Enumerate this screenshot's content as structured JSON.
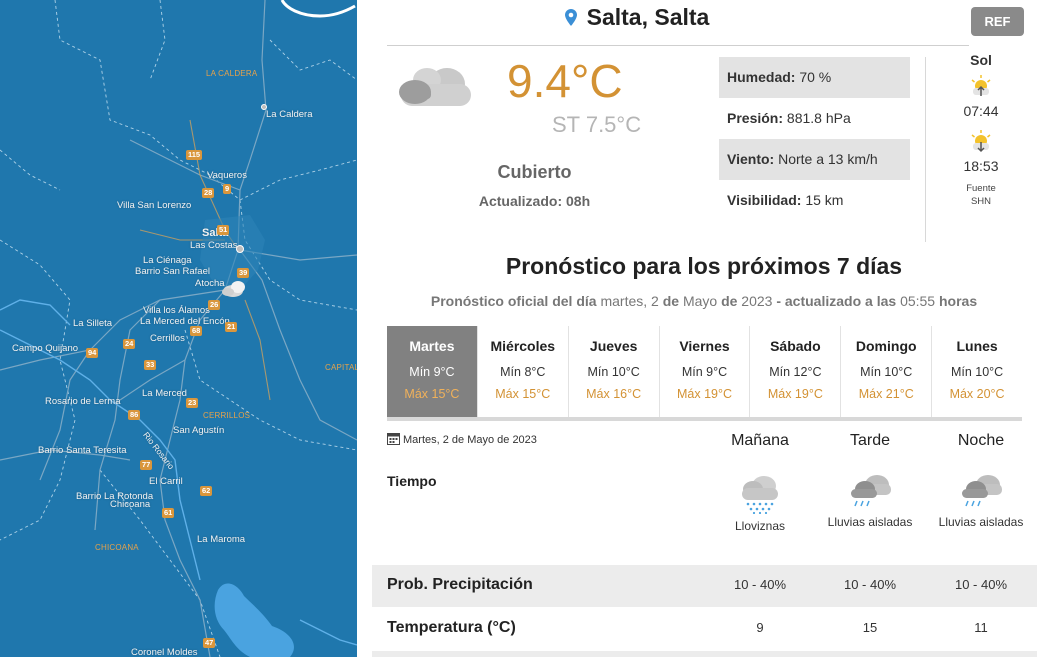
{
  "map": {
    "cities": [
      {
        "name": "La Caldera",
        "style": "city"
      },
      {
        "name": "Vaqueros",
        "style": "city"
      },
      {
        "name": "Villa San Lorenzo",
        "style": "city"
      },
      {
        "name": "Salta",
        "style": "big"
      },
      {
        "name": "Las Costas",
        "style": "city"
      },
      {
        "name": "La Ciénaga",
        "style": "city"
      },
      {
        "name": "Barrio San Rafael",
        "style": "city"
      },
      {
        "name": "Atocha",
        "style": "city"
      },
      {
        "name": "Villa los Álamos",
        "style": "city"
      },
      {
        "name": "La Merced del Encón",
        "style": "city"
      },
      {
        "name": "La Silleta",
        "style": "city"
      },
      {
        "name": "Cerrillos",
        "style": "city"
      },
      {
        "name": "Campo Quijano",
        "style": "city"
      },
      {
        "name": "La Merced",
        "style": "city"
      },
      {
        "name": "Rosario de Lerma",
        "style": "city"
      },
      {
        "name": "San Agustín",
        "style": "city"
      },
      {
        "name": "Barrio Santa Teresita",
        "style": "city"
      },
      {
        "name": "El Carril",
        "style": "city"
      },
      {
        "name": "Barrio La Rotonda",
        "style": "city"
      },
      {
        "name": "Chicoana",
        "style": "city"
      },
      {
        "name": "La Maroma",
        "style": "city"
      },
      {
        "name": "Coronel Moldes",
        "style": "city"
      }
    ],
    "regions": [
      "LA CALDERA",
      "CERRILLOS",
      "CHICOANA",
      "CAPITAL"
    ],
    "river": "Rio Rosario",
    "routes": [
      "9",
      "28",
      "39",
      "51",
      "26",
      "21",
      "24",
      "94",
      "33",
      "23",
      "47",
      "68",
      "77",
      "86",
      "62",
      "61",
      "115"
    ]
  },
  "location": {
    "name": "Salta, Salta",
    "ref_button": "REF"
  },
  "current": {
    "temperature": "9.4°C",
    "feels_like": "ST 7.5°C",
    "condition": "Cubierto",
    "updated": "Actualizado: 08h",
    "icon": "cloud-icon"
  },
  "stats": [
    {
      "label": "Humedad:",
      "value": "70 %"
    },
    {
      "label": "Presión:",
      "value": "881.8 hPa"
    },
    {
      "label": "Viento:",
      "value": "Norte a 13 km/h"
    },
    {
      "label": "Visibilidad:",
      "value": "15 km"
    }
  ],
  "sun": {
    "title": "Sol",
    "sunrise": "07:44",
    "sunset": "18:53",
    "source_label": "Fuente",
    "source": "SHN"
  },
  "forecast": {
    "title": "Pronóstico para los próximos 7 días",
    "subtitle_prefix": "Pronóstico oficial del día",
    "subtitle_date_1": "martes, 2",
    "subtitle_de_1": "de",
    "subtitle_date_2": "Mayo",
    "subtitle_de_2": "de",
    "subtitle_date_3": "2023",
    "subtitle_updated": "- actualizado a las",
    "subtitle_time": "05:55",
    "subtitle_suffix": "horas",
    "days": [
      {
        "name": "Martes",
        "min": "Mín 9°C",
        "max": "Máx 15°C",
        "active": true
      },
      {
        "name": "Miércoles",
        "min": "Mín 8°C",
        "max": "Máx 15°C"
      },
      {
        "name": "Jueves",
        "min": "Mín 10°C",
        "max": "Máx 16°C"
      },
      {
        "name": "Viernes",
        "min": "Mín 9°C",
        "max": "Máx 19°C"
      },
      {
        "name": "Sábado",
        "min": "Mín 12°C",
        "max": "Máx 19°C"
      },
      {
        "name": "Domingo",
        "min": "Mín 10°C",
        "max": "Máx 21°C"
      },
      {
        "name": "Lunes",
        "min": "Mín 10°C",
        "max": "Máx 20°C"
      }
    ]
  },
  "detail": {
    "date": "Martes, 2 de Mayo de 2023",
    "periods": [
      "Mañana",
      "Tarde",
      "Noche"
    ],
    "weather_label": "Tiempo",
    "weather": [
      {
        "text": "Lloviznas",
        "icon": "drizzle-icon"
      },
      {
        "text": "Lluvias aisladas",
        "icon": "isolated-rain-icon"
      },
      {
        "text": "Lluvias aisladas",
        "icon": "isolated-rain-icon"
      }
    ],
    "precip_label": "Prob. Precipitación",
    "precip": [
      "10 - 40%",
      "10 - 40%",
      "10 - 40%"
    ],
    "temp_label": "Temperatura (°C)",
    "temps": [
      "9",
      "15",
      "11"
    ]
  }
}
